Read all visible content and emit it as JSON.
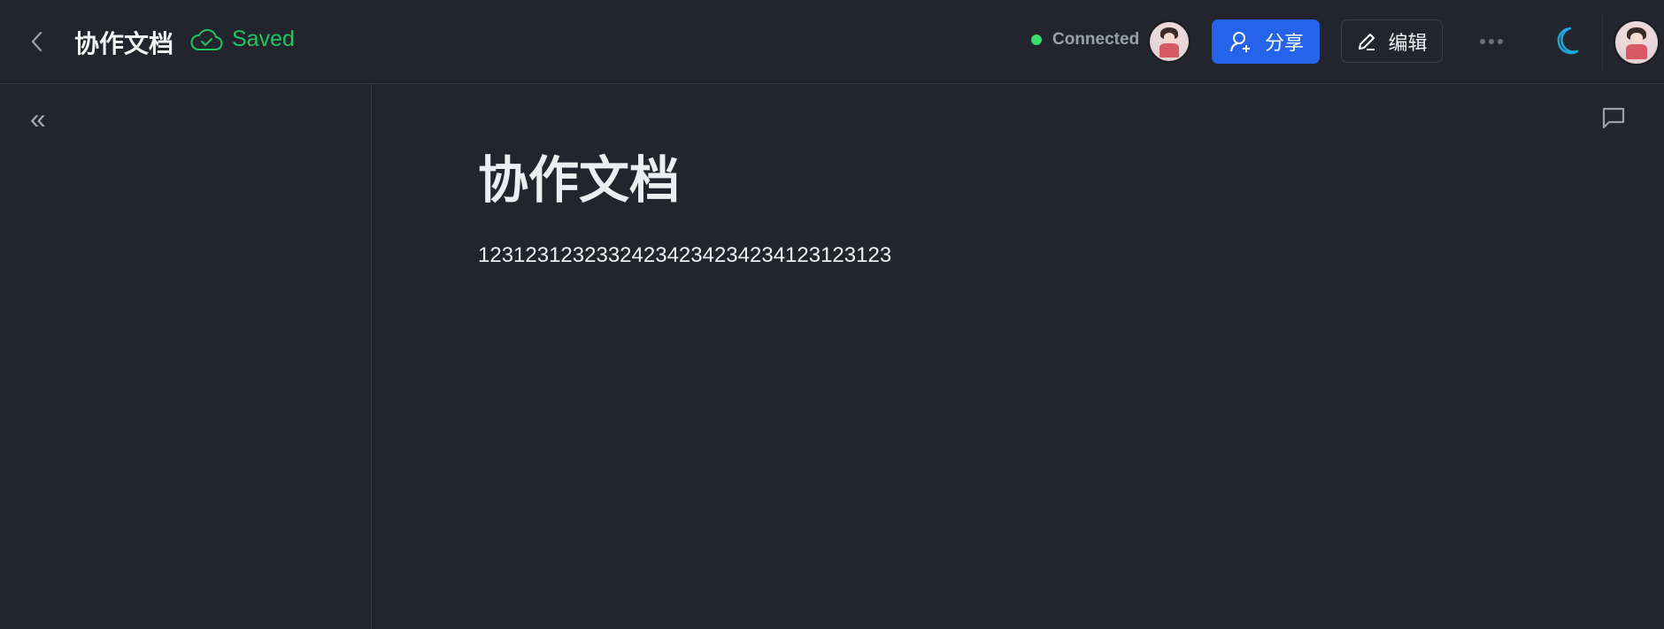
{
  "header": {
    "title": "协作文档",
    "save_status": "Saved",
    "connection_status": "Connected",
    "share_label": "分享",
    "edit_label": "编辑",
    "colors": {
      "accent": "#2563eb",
      "saved": "#22c55e",
      "connected": "#3ddc6e",
      "moon": "#1ea6d6"
    }
  },
  "document": {
    "heading": "协作文档",
    "body": "12312312323324234234234234123123123"
  }
}
